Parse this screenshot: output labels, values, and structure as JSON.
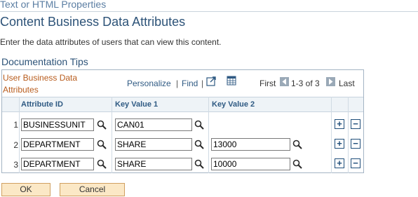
{
  "header": {
    "top_link": "Text or HTML Properties",
    "title": "Content Business Data Attributes",
    "description": "Enter the data attributes of users that can view this content.",
    "doc_tips": "Documentation Tips"
  },
  "grid": {
    "title_line1": "User Business Data",
    "title_line2": "Attributes",
    "nav": {
      "personalize": "Personalize",
      "sep": "|",
      "find": "Find",
      "first": "First",
      "range": "1-3 of 3",
      "last": "Last"
    },
    "columns": [
      "Attribute ID",
      "Key Value 1",
      "Key Value 2"
    ],
    "rows": [
      {
        "num": "1",
        "attr": "BUSINESSUNIT",
        "key1": "CAN01",
        "key2": ""
      },
      {
        "num": "2",
        "attr": "DEPARTMENT",
        "key1": "SHARE",
        "key2": "13000"
      },
      {
        "num": "3",
        "attr": "DEPARTMENT",
        "key1": "SHARE",
        "key2": "10000"
      }
    ],
    "add_symbol": "+",
    "remove_symbol": "−"
  },
  "buttons": {
    "ok": "OK",
    "cancel": "Cancel"
  },
  "colors": {
    "heading": "#2d5378",
    "grid_title": "#b85c1d",
    "link": "#2f5a83",
    "button_bg": "#fbe8c6"
  }
}
